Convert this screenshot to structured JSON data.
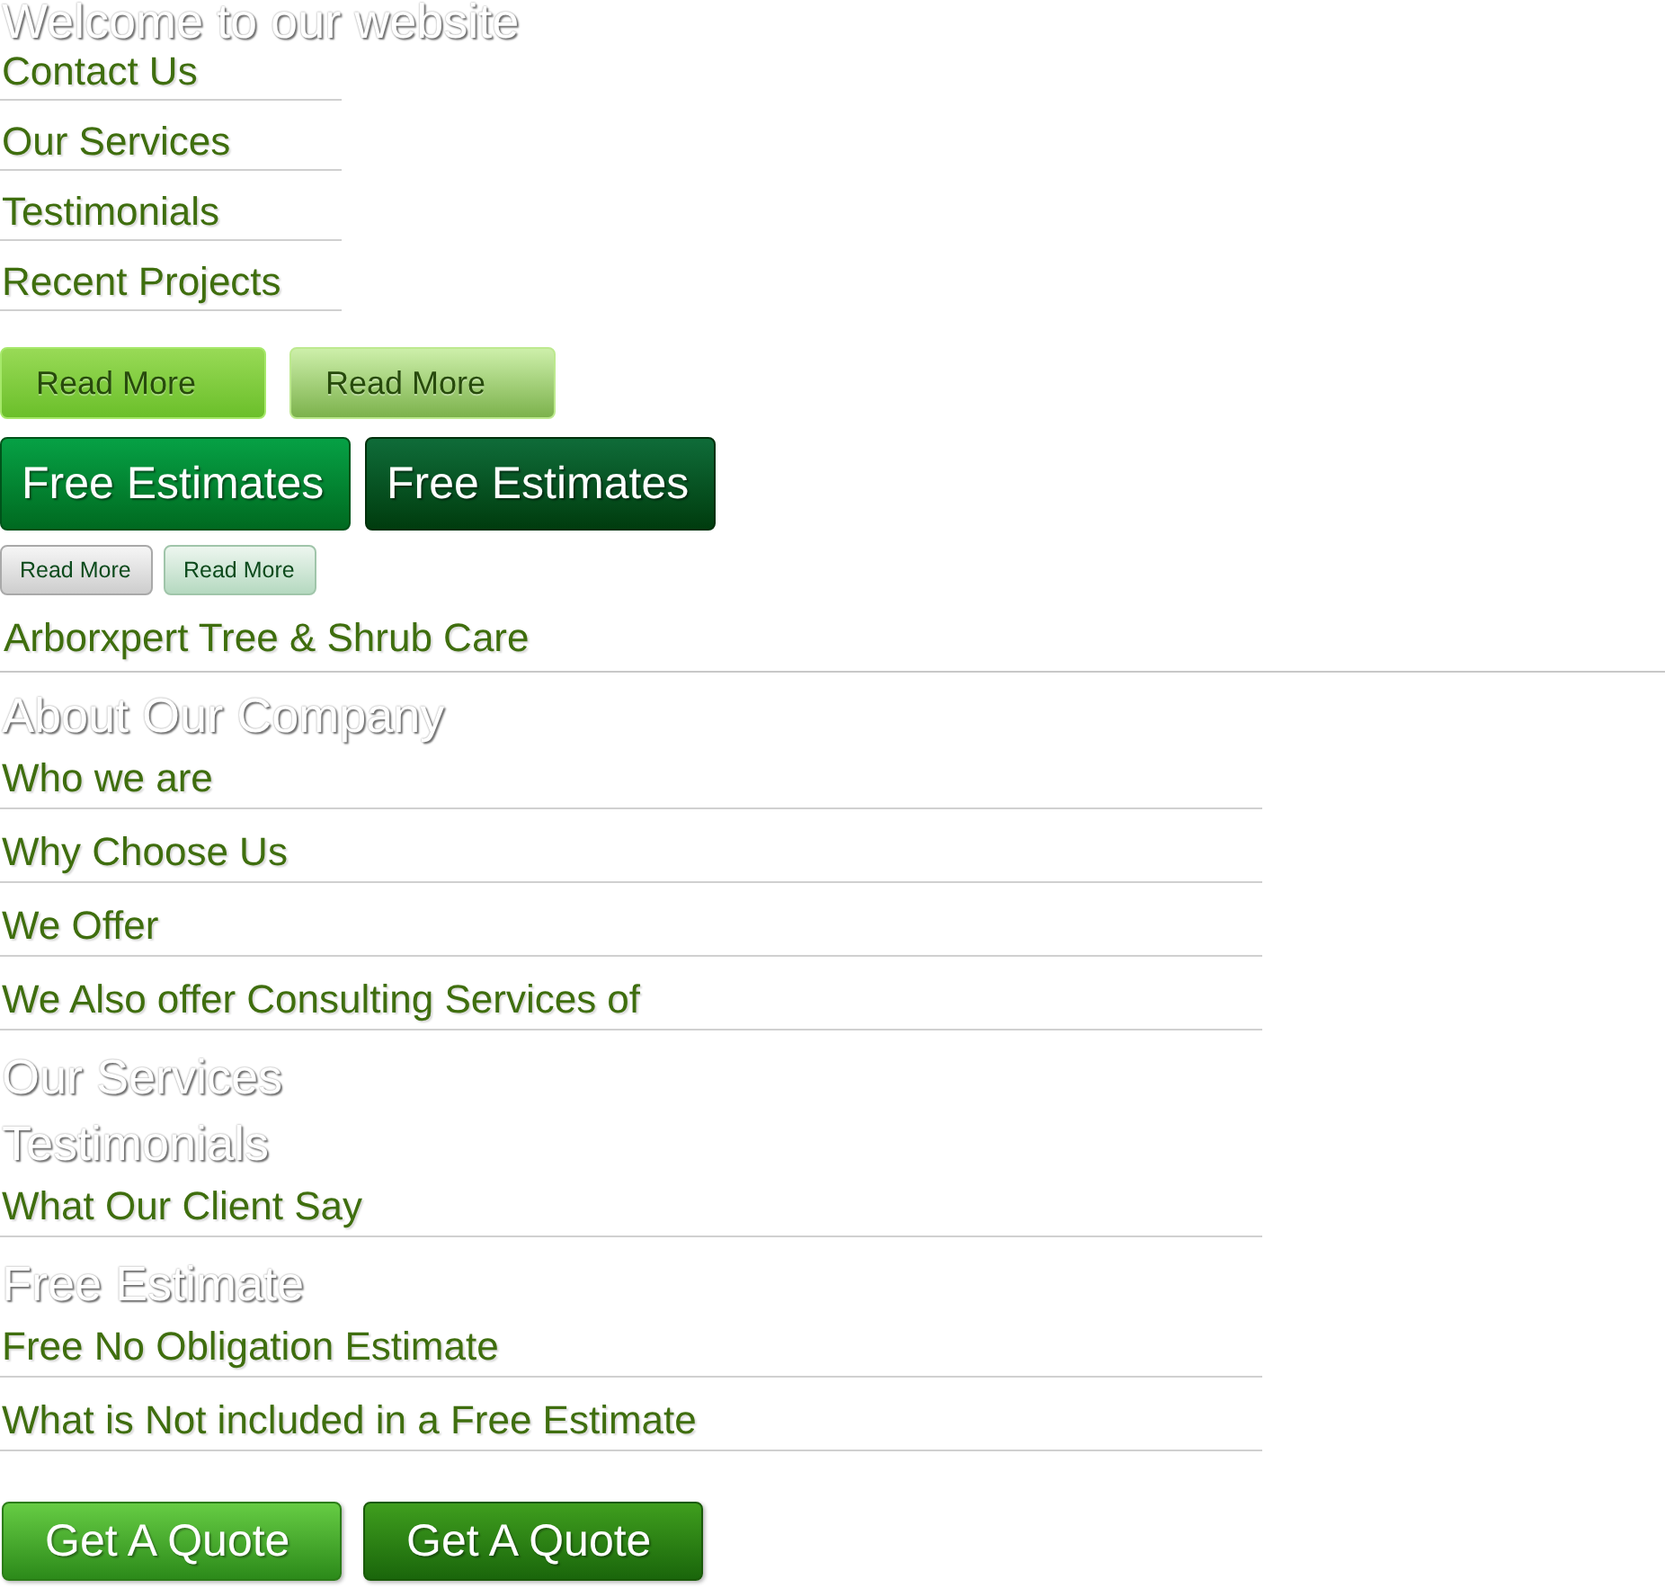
{
  "blocks": [
    {
      "kind": "heading",
      "text": "Welcome to our website"
    },
    {
      "kind": "menu",
      "items": [
        "Contact Us",
        "Our Services",
        "Testimonials",
        "Recent Projects"
      ]
    },
    {
      "kind": "buttons",
      "buttons": [
        {
          "label": "Read More",
          "kind": "lime"
        },
        {
          "label": "Read More",
          "kind": "sage"
        }
      ]
    },
    {
      "kind": "buttons",
      "buttons": [
        {
          "label": "Free Estimates",
          "kind": "emerald"
        },
        {
          "label": "Free Estimates",
          "kind": "forest"
        }
      ]
    },
    {
      "kind": "buttons",
      "buttons": [
        {
          "label": "Read More",
          "kind": "silver"
        },
        {
          "label": "Read More",
          "kind": "mint"
        }
      ]
    },
    {
      "kind": "banner",
      "text": "Arborxpert Tree & Shrub Care"
    },
    {
      "kind": "heading",
      "text": "About Our Company"
    },
    {
      "kind": "list",
      "items": [
        "Who we are",
        "Why Choose Us",
        "We Offer",
        "We Also offer Consulting Services of"
      ]
    },
    {
      "kind": "heading",
      "text": "Our Services"
    },
    {
      "kind": "heading",
      "text": "Testimonials"
    },
    {
      "kind": "list",
      "items": [
        "What Our Client Say"
      ]
    },
    {
      "kind": "heading",
      "text": "Free Estimate"
    },
    {
      "kind": "list",
      "items": [
        "Free No Obligation Estimate",
        "What is Not included in a Free Estimate"
      ]
    },
    {
      "kind": "buttons",
      "buttons": [
        {
          "label": "Get A Quote",
          "kind": "grass"
        },
        {
          "label": "Get A Quote",
          "kind": "pine"
        }
      ]
    }
  ]
}
